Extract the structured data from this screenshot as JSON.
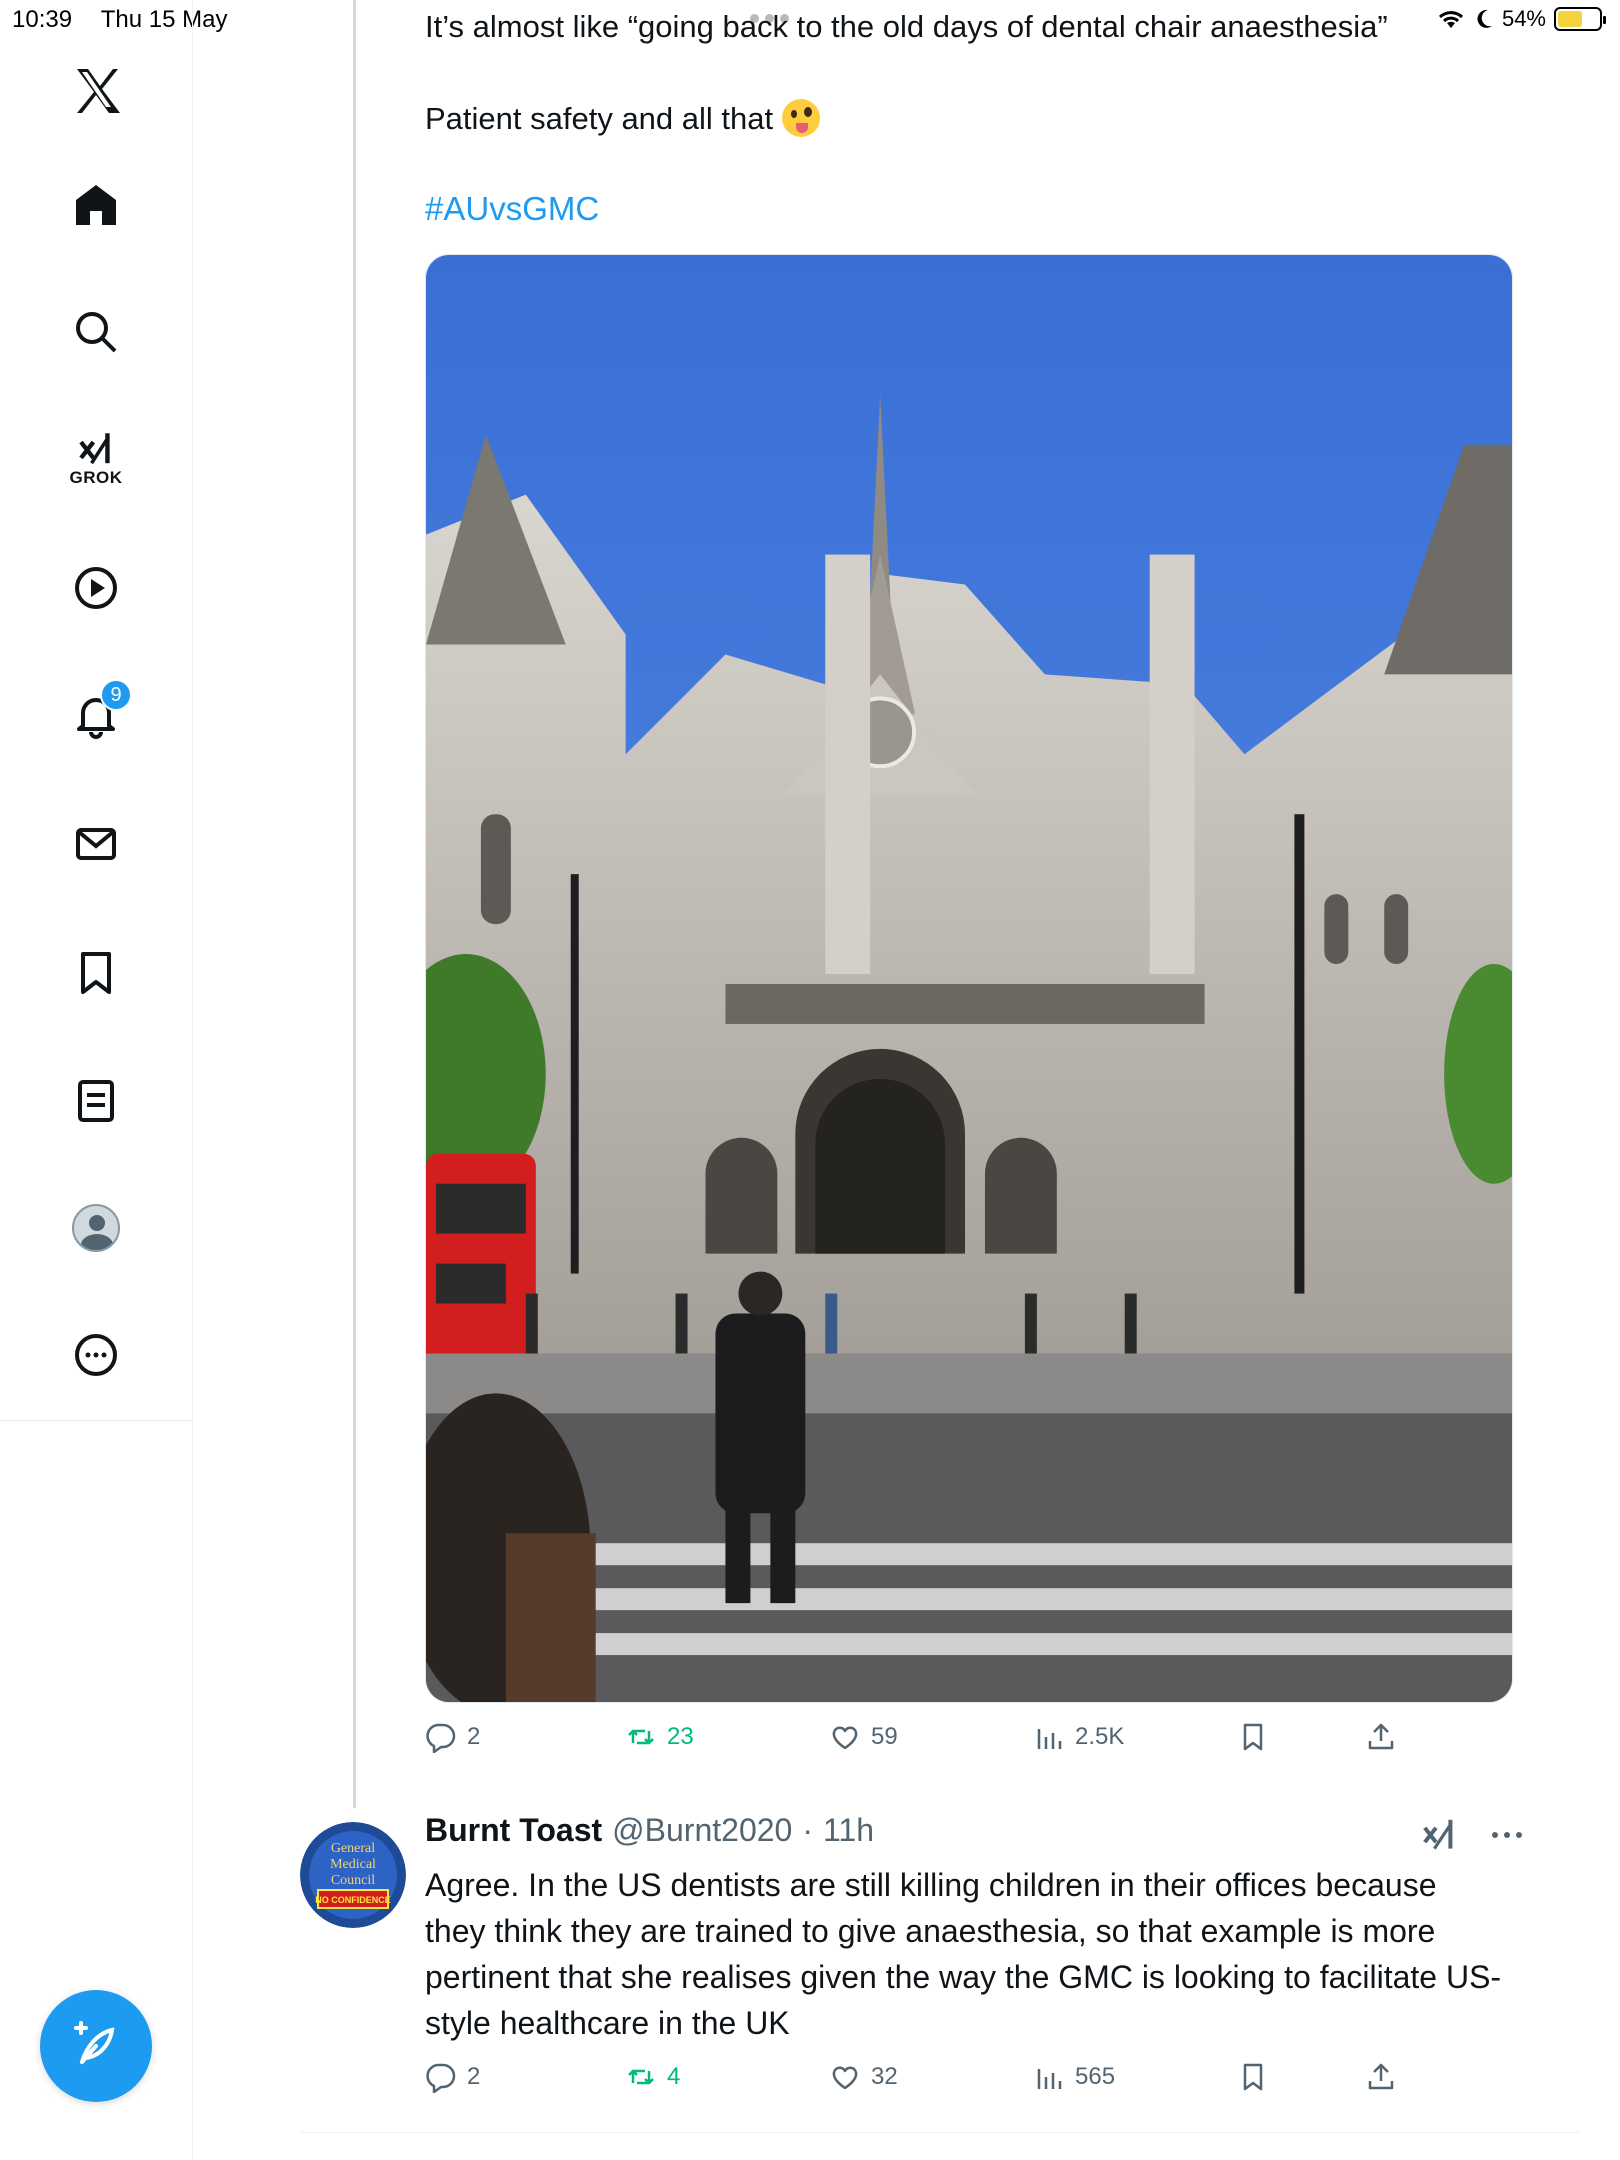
{
  "status_bar": {
    "time": "10:39",
    "date": "Thu 15 May",
    "battery": "54%",
    "battery_level": 0.54
  },
  "sidebar": {
    "logo": "x-logo-icon",
    "grok_label": "GROK",
    "notifications_badge": "9",
    "items": [
      "home-icon",
      "search-icon",
      "grok-icon",
      "video-icon",
      "bell-icon",
      "mail-icon",
      "bookmark-icon",
      "list-icon",
      "profile-icon",
      "more-icon"
    ]
  },
  "tweet": {
    "line1": "It’s almost like “going back to the old days of dental chair anaesthesia”",
    "line2": "Patient safety and all that",
    "hashtag": "#AUvsGMC",
    "stats": {
      "replies": "2",
      "reposts": "23",
      "likes": "59",
      "views": "2.5K"
    }
  },
  "reply": {
    "name": "Burnt Toast",
    "handle": "@Burnt2020",
    "separator": "·",
    "time": "11h",
    "avatar_text": [
      "General",
      "Medical",
      "Council"
    ],
    "avatar_badge": "NO CONFIDENCE",
    "text": "Agree. In the US dentists are still killing children in their offices because they think they are trained to give anaesthesia, so that example is more pertinent that she realises given the way the GMC is looking to facilitate US-style healthcare in the UK",
    "stats": {
      "replies": "2",
      "reposts": "4",
      "likes": "32",
      "views": "565"
    }
  },
  "colors": {
    "accent": "#1d9bf0",
    "repost": "#00ba7c",
    "muted": "#536471",
    "text": "#0f1419"
  }
}
